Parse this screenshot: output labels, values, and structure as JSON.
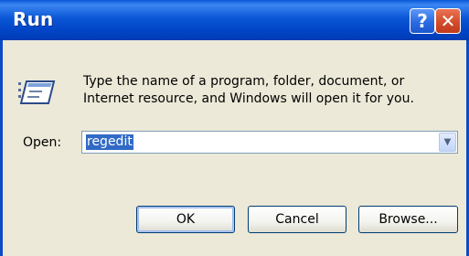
{
  "window": {
    "title": "Run",
    "help_label": "?",
    "close_label": "✕"
  },
  "dialog": {
    "description_line1": "Type the name of a program, folder, document, or",
    "description_line2": "Internet resource, and Windows will open it for you.",
    "open_label": "Open:",
    "open_value": "regedit"
  },
  "buttons": {
    "ok": "OK",
    "cancel": "Cancel",
    "browse": "Browse..."
  },
  "icons": {
    "run": "run-program-icon",
    "dropdown": "chevron-down-icon"
  }
}
